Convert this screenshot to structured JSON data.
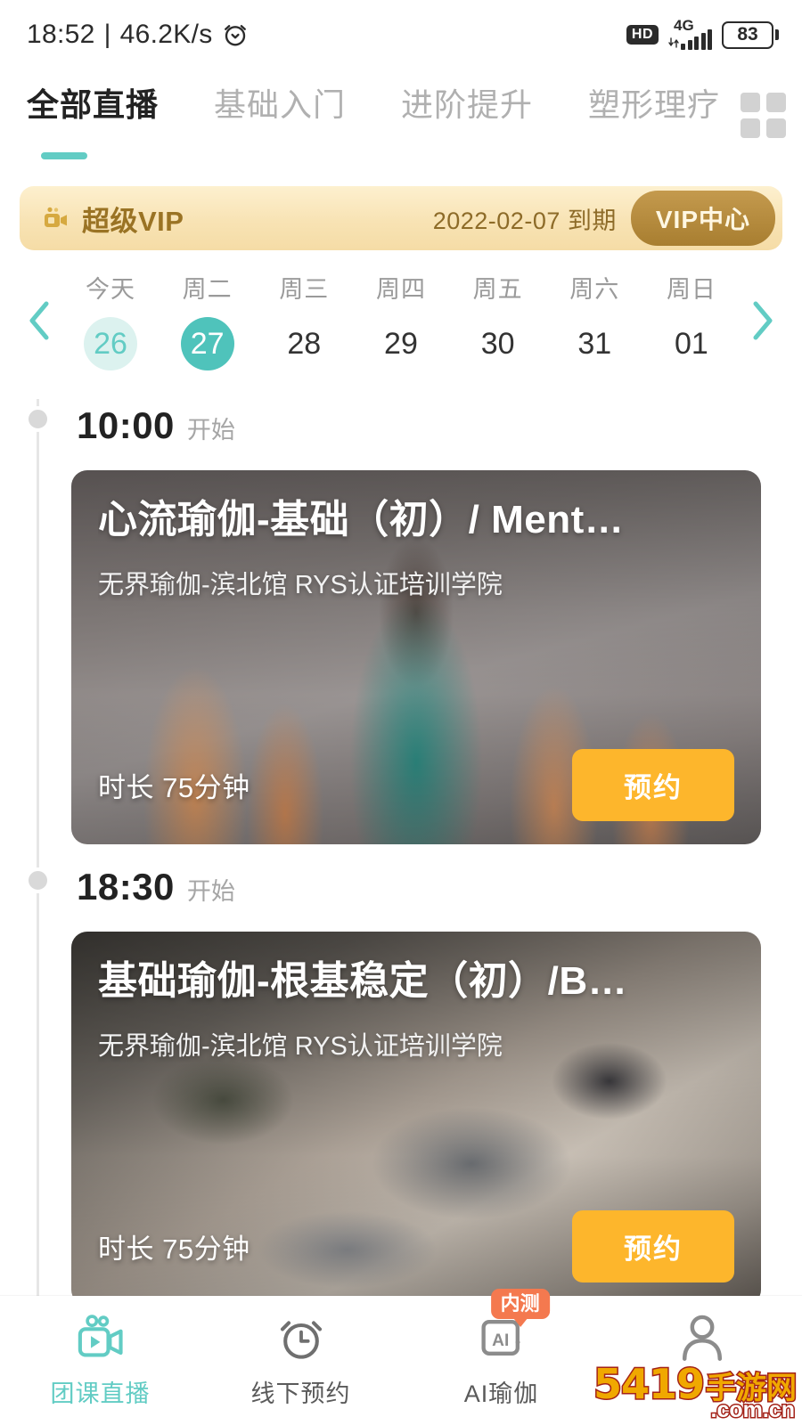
{
  "status_bar": {
    "time": "18:52",
    "separator": "|",
    "network_speed": "46.2K/s",
    "alarm_icon": "alarm-clock-icon",
    "hd_label": "HD",
    "network_type": "4G",
    "battery_level": "83"
  },
  "top_tabs": {
    "items": [
      {
        "label": "全部直播",
        "active": true
      },
      {
        "label": "基础入门",
        "active": false
      },
      {
        "label": "进阶提升",
        "active": false
      },
      {
        "label": "塑形理疗",
        "active": false
      }
    ],
    "grid_icon": "grid-menu-icon",
    "accent_color": "#62ccc4"
  },
  "vip_banner": {
    "icon": "video-camera-icon",
    "title": "超级VIP",
    "expire_text": "2022-02-07 到期",
    "button_label": "VIP中心",
    "background_color": "#f8e3b4",
    "text_color": "#9a7324",
    "button_color": "#a87e30"
  },
  "date_strip": {
    "prev_icon": "chevron-left-icon",
    "next_icon": "chevron-right-icon",
    "days": [
      {
        "name": "今天",
        "num": "26",
        "state": "today"
      },
      {
        "name": "周二",
        "num": "27",
        "state": "selected"
      },
      {
        "name": "周三",
        "num": "28",
        "state": "normal"
      },
      {
        "name": "周四",
        "num": "29",
        "state": "normal"
      },
      {
        "name": "周五",
        "num": "30",
        "state": "normal"
      },
      {
        "name": "周六",
        "num": "31",
        "state": "normal"
      },
      {
        "name": "周日",
        "num": "01",
        "state": "normal"
      }
    ],
    "selected_color": "#4fc3bb",
    "today_color": "#dcf2ef"
  },
  "schedule": {
    "slots": [
      {
        "time": "10:00",
        "time_suffix": "开始",
        "card": {
          "title": "心流瑜伽-基础（初）/ Ment…",
          "studio": "无界瑜伽-滨北馆 RYS认证培训学院",
          "duration": "时长 75分钟",
          "book_label": "预约",
          "book_color": "#fdb62c"
        }
      },
      {
        "time": "18:30",
        "time_suffix": "开始",
        "card": {
          "title": "基础瑜伽-根基稳定（初）/B…",
          "studio": "无界瑜伽-滨北馆 RYS认证培训学院",
          "duration": "时长 75分钟",
          "book_label": "预约",
          "book_color": "#fdb62c"
        }
      }
    ]
  },
  "bottom_nav": {
    "items": [
      {
        "label": "团课直播",
        "icon": "video-camera-icon",
        "active": true
      },
      {
        "label": "线下预约",
        "icon": "alarm-clock-icon",
        "active": false
      },
      {
        "label": "AI瑜伽",
        "icon": "ai-card-icon",
        "active": false,
        "badge": "内测"
      },
      {
        "label": "",
        "icon": "user-profile-icon",
        "active": false
      }
    ],
    "active_color": "#62ccc4",
    "badge_color": "#f4794f"
  },
  "watermark": {
    "number": "5419",
    "cn": "手游网",
    "domain": ".com.cn"
  }
}
